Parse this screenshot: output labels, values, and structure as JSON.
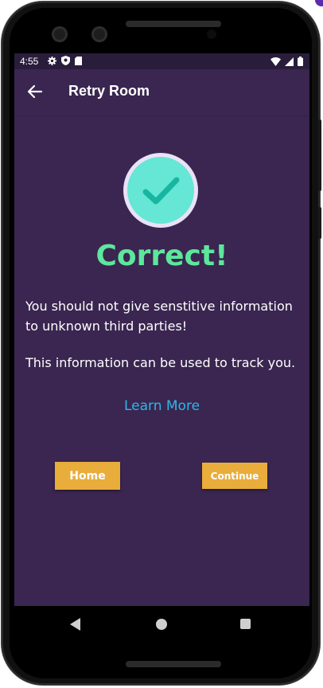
{
  "status_bar": {
    "time": "4:55",
    "left_icons": [
      "settings-icon",
      "shield-icon",
      "sd-card-icon"
    ],
    "right_icons": [
      "wifi-icon",
      "signal-icon",
      "battery-icon"
    ]
  },
  "app_bar": {
    "back_icon": "arrow-left-icon",
    "title": "Retry Room"
  },
  "result": {
    "icon": "checkmark-icon",
    "title": "Correct!",
    "message_1": "You should not give senstitive information to unknown third parties!",
    "message_2": "This information can be used to track you.",
    "learn_more": "Learn More"
  },
  "buttons": {
    "home": "Home",
    "continue": "Continue"
  },
  "colors": {
    "background": "#3a2650",
    "accent_green": "#5ee69c",
    "circle": "#66e6d4",
    "link": "#2fb6e8",
    "button": "#e9ad3c"
  }
}
